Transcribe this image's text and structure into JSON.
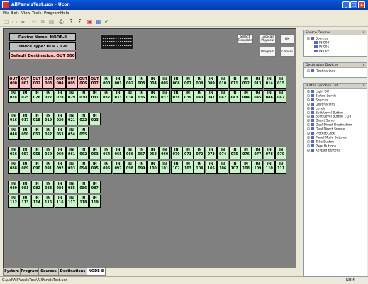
{
  "window": {
    "title": "AllPanelsTest.ucn - Ucon"
  },
  "menu": [
    "File",
    "Edit",
    "View",
    "Tools",
    "Program",
    "Help"
  ],
  "device": {
    "name": "Device Name: NODE-8",
    "type": "Device Type: UCP - 128",
    "default_destination": "Default Destination: OUT  000"
  },
  "buttons": {
    "select_template": "Select Template",
    "logical_physical": "Logical/ Physical",
    "ok": "OK",
    "program": "Program",
    "cancel": "Cancel"
  },
  "rows": [
    {
      "cells": [
        [
          "OUT",
          "000",
          "out"
        ],
        [
          "OUT",
          "001",
          "out"
        ],
        [
          "OUT",
          "002",
          "out"
        ],
        [
          "OUT",
          "003",
          "out"
        ],
        [
          "OUT",
          "004",
          "out"
        ],
        [
          "OUT",
          "005",
          "out"
        ],
        [
          "OUT",
          "006",
          "out"
        ],
        [
          "OUT",
          "007",
          "out"
        ],
        [
          "IN",
          "000",
          "in"
        ],
        [
          "IN",
          "001",
          "in"
        ],
        [
          "IN",
          "002",
          "in"
        ],
        [
          "IN",
          "003",
          "in"
        ],
        [
          "IN",
          "004",
          "in"
        ],
        [
          "IN",
          "005",
          "in"
        ],
        [
          "IN",
          "006",
          "in"
        ],
        [
          "IN",
          "007",
          "in"
        ],
        [
          "IN",
          "008",
          "in"
        ],
        [
          "IN",
          "009",
          "in"
        ],
        [
          "IN",
          "010",
          "in"
        ],
        [
          "IN",
          "011",
          "in"
        ],
        [
          "IN",
          "012",
          "in"
        ],
        [
          "IN",
          "013",
          "in"
        ],
        [
          "IN",
          "014",
          "in"
        ],
        [
          "IN",
          "015",
          "in"
        ]
      ]
    },
    {
      "cells": [
        [
          "IN",
          "024",
          "in"
        ],
        [
          "IN",
          "025",
          "in"
        ],
        [
          "IN",
          "026",
          "in"
        ],
        [
          "IN",
          "027",
          "in"
        ],
        [
          "IN",
          "028",
          "in"
        ],
        [
          "IN",
          "029",
          "in"
        ],
        [
          "IN",
          "030",
          "in"
        ],
        [
          "IN",
          "031",
          "in"
        ],
        [
          "IN",
          "032",
          "in"
        ],
        [
          "IN",
          "033",
          "in"
        ],
        [
          "IN",
          "034",
          "in"
        ],
        [
          "IN",
          "035",
          "in"
        ],
        [
          "IN",
          "036",
          "in"
        ],
        [
          "IN",
          "037",
          "in"
        ],
        [
          "IN",
          "038",
          "in"
        ],
        [
          "IN",
          "039",
          "in"
        ],
        [
          "IN",
          "040",
          "in"
        ],
        [
          "IN",
          "041",
          "in"
        ],
        [
          "IN",
          "042",
          "in"
        ],
        [
          "IN",
          "043",
          "in"
        ],
        [
          "IN",
          "044",
          "in"
        ],
        [
          "IN",
          "045",
          "in"
        ],
        [
          "IN",
          "046",
          "in"
        ],
        [
          "IN",
          "047",
          "in"
        ]
      ]
    },
    {
      "cells": [
        [
          "IN",
          "016",
          "in"
        ],
        [
          "IN",
          "017",
          "in"
        ],
        [
          "IN",
          "018",
          "in"
        ],
        [
          "IN",
          "019",
          "in"
        ],
        [
          "IN",
          "020",
          "in"
        ],
        [
          "IN",
          "021",
          "in"
        ],
        [
          "IN",
          "022",
          "in"
        ],
        [
          "IN",
          "023",
          "in"
        ]
      ]
    },
    {
      "cells": [
        [
          "IN",
          "048",
          "in"
        ],
        [
          "IN",
          "050",
          "in"
        ],
        [
          "IN",
          "051",
          "in"
        ],
        [
          "IN",
          "052",
          "in"
        ],
        [
          "IN",
          "053",
          "in"
        ],
        [
          "IN",
          "054",
          "in"
        ],
        [
          "IN",
          "055",
          "in"
        ]
      ]
    },
    {
      "cells": [
        [
          "IN",
          "056",
          "in"
        ],
        [
          "IN",
          "057",
          "in"
        ],
        [
          "IN",
          "058",
          "in"
        ],
        [
          "IN",
          "059",
          "in"
        ],
        [
          "IN",
          "060",
          "in"
        ],
        [
          "IN",
          "061",
          "in"
        ],
        [
          "IN",
          "062",
          "in"
        ],
        [
          "IN",
          "063",
          "in"
        ],
        [
          "IN",
          "064",
          "in"
        ],
        [
          "IN",
          "065",
          "in"
        ],
        [
          "IN",
          "066",
          "in"
        ],
        [
          "IN",
          "067",
          "in"
        ],
        [
          "IN",
          "068",
          "in"
        ],
        [
          "IN",
          "069",
          "in"
        ],
        [
          "IN",
          "070",
          "in"
        ],
        [
          "IN",
          "071",
          "in"
        ],
        [
          "IN",
          "072",
          "in"
        ],
        [
          "IN",
          "073",
          "in"
        ],
        [
          "IN",
          "074",
          "in"
        ],
        [
          "IN",
          "075",
          "in"
        ],
        [
          "IN",
          "076",
          "in"
        ],
        [
          "IN",
          "077",
          "in"
        ],
        [
          "IN",
          "078",
          "in"
        ],
        [
          "IN",
          "079",
          "in"
        ]
      ]
    },
    {
      "cells": [
        [
          "IN",
          "088",
          "in"
        ],
        [
          "IN",
          "089",
          "in"
        ],
        [
          "IN",
          "090",
          "in"
        ],
        [
          "IN",
          "091",
          "in"
        ],
        [
          "IN",
          "092",
          "in"
        ],
        [
          "IN",
          "093",
          "in"
        ],
        [
          "IN",
          "094",
          "in"
        ],
        [
          "IN",
          "095",
          "in"
        ],
        [
          "IN",
          "096",
          "in"
        ],
        [
          "IN",
          "097",
          "in"
        ],
        [
          "IN",
          "098",
          "in"
        ],
        [
          "IN",
          "099",
          "in"
        ],
        [
          "IN",
          "100",
          "in"
        ],
        [
          "IN",
          "101",
          "in"
        ],
        [
          "IN",
          "102",
          "in"
        ],
        [
          "IN",
          "103",
          "in"
        ],
        [
          "IN",
          "104",
          "in"
        ],
        [
          "IN",
          "105",
          "in"
        ],
        [
          "IN",
          "106",
          "in"
        ],
        [
          "IN",
          "107",
          "in"
        ],
        [
          "IN",
          "108",
          "in"
        ],
        [
          "IN",
          "109",
          "in"
        ],
        [
          "IN",
          "110",
          "in"
        ],
        [
          "IN",
          "111",
          "in"
        ]
      ]
    },
    {
      "cells": [
        [
          "IN",
          "080",
          "in"
        ],
        [
          "IN",
          "081",
          "in"
        ],
        [
          "IN",
          "082",
          "in"
        ],
        [
          "IN",
          "083",
          "in"
        ],
        [
          "IN",
          "084",
          "in"
        ],
        [
          "IN",
          "085",
          "in"
        ],
        [
          "IN",
          "086",
          "in"
        ],
        [
          "IN",
          "087",
          "in"
        ]
      ]
    },
    {
      "cells": [
        [
          "IN",
          "112",
          "in"
        ],
        [
          "IN",
          "113",
          "in"
        ],
        [
          "IN",
          "114",
          "in"
        ],
        [
          "IN",
          "115",
          "in"
        ],
        [
          "IN",
          "116",
          "in"
        ],
        [
          "IN",
          "117",
          "in"
        ],
        [
          "IN",
          "118",
          "in"
        ],
        [
          "IN",
          "119",
          "in"
        ]
      ]
    }
  ],
  "tabs": [
    "System",
    "Program",
    "Sources",
    "Destinations",
    "NODE-8"
  ],
  "active_tab": "NODE-8",
  "status": {
    "path": "C:\\ucl\\AllPanelsTest\\AllPanelsTest.ucn",
    "num": "NUM"
  },
  "panels": {
    "source": {
      "title": "Source Devices",
      "items": [
        "Sources",
        "IN  000",
        "IN  001",
        "IN  002"
      ]
    },
    "destination": {
      "title": "Destination Devices",
      "items": [
        "Destinations"
      ]
    },
    "functions": {
      "title": "Button Function List",
      "items": [
        "Light Off",
        "Status Levels",
        "Sources",
        "Destinations",
        "Levels",
        "Split Level Button",
        "Split Level Button 1-16",
        "Direct Salvo",
        "Dual Direct Destination",
        "Dual Direct Source",
        "Protect/Lock",
        "Panel Mode Buttons",
        "Take Button",
        "Page Buttons",
        "Keypad Buttons"
      ]
    }
  },
  "colors": {
    "out_cell": "#ffc4c4",
    "in_cell": "#c8f5c8",
    "canvas": "#808080"
  }
}
